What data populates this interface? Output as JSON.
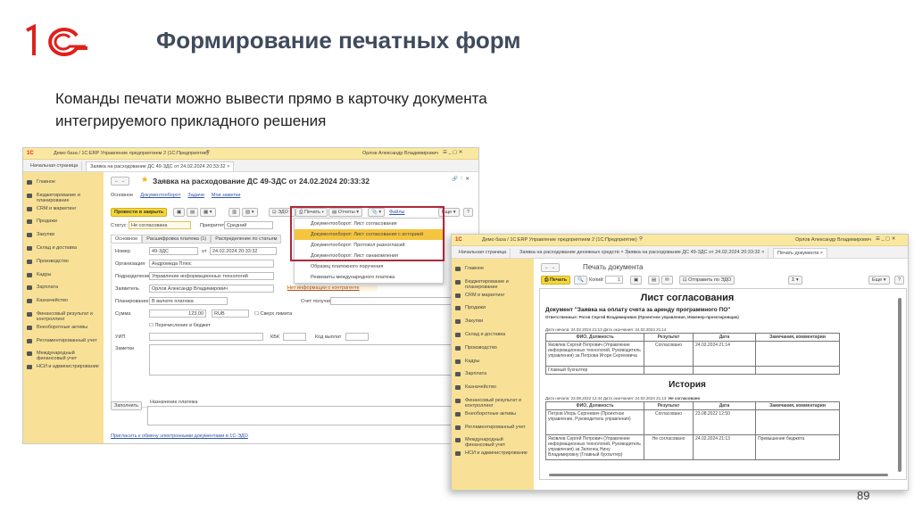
{
  "slide": {
    "title": "Формирование печатных форм",
    "subtitle_line1": "Команды печати можно вывести прямо в карточку документа",
    "subtitle_line2": "интегрируемого прикладного решения",
    "page_number": "89",
    "logo_text": "1С",
    "title_color": "#3f4a5c",
    "logo_color": "#e0201b"
  },
  "win1": {
    "title": "Демо база / 1С:ERP Управление предприятием 2  (1С:Предприятие)",
    "user": "Орлов Александр Владимирович",
    "tabs": [
      "Начальная страница",
      "Заявка на расходование ДС 49-ЗДС от 24.02.2024 20:33:32 ×"
    ],
    "sidebar": [
      "Главное",
      "Бюджетирование и планирование",
      "CRM и маркетинг",
      "Продажи",
      "Закупки",
      "Склад и доставка",
      "Производство",
      "Кадры",
      "Зарплата",
      "Казначейство",
      "Финансовый результат и контроллинг",
      "Внеоборотные активы",
      "Регламентированный учет",
      "Международный финансовый учет",
      "НСИ и администрирование"
    ],
    "header": "Заявка на расходование ДС 49-ЗДС от 24.02.2024 20:33:32",
    "nav": [
      "Основное",
      "Документооборот",
      "Задачи",
      "Мои заметки"
    ],
    "toolbar": {
      "post_close": "Провести и закрыть",
      "edo": "ЭДО",
      "print": "Печать",
      "reports": "Отчеты",
      "files": "Файлы",
      "more": "Еще",
      "help": "?"
    },
    "print_menu": [
      "Документооборот: Лист согласования",
      "Документооборот: Лист согласования с историей",
      "Документооборот: Протокол разногласий",
      "Документооборот: Лист ознакомления",
      "Образец платежного поручения",
      "Реквизиты международного платежа"
    ],
    "status_label": "Статус:",
    "status": "Не согласована",
    "priority_label": "Приоритет:",
    "priority": "Средний",
    "form_tabs": [
      "Основное",
      "Расшифровка платежа (1)",
      "Распределение по статьям"
    ],
    "fields": {
      "number_label": "Номер",
      "number": "49-ЗДС",
      "date_label": "от",
      "date": "24.02.2024 20:33:32",
      "org_label": "Организация",
      "org": "Андромеда Плюс",
      "dept_label": "Подразделение",
      "dept": "Управление информационных технологий",
      "applicant_label": "Заявитель",
      "applicant": "Орлов Александр Владимирович",
      "no_info": "Нет информации о контрагенте",
      "planning_label": "Планирование",
      "planning": "В валюте платежа",
      "account_label": "Счет получателя",
      "sum_label": "Сумма",
      "sum": "123,00",
      "currency": "RUB",
      "over_limit": "Сверх лимита",
      "budget": "Перечисление в бюджет",
      "uip_label": "УИП",
      "kbk_label": "КБК",
      "code_label": "Код выплат",
      "notes_label": "Заметки",
      "fill": "Заполнить",
      "purpose_label": "Назначение платежа",
      "invite": "Пригласить к обмену электронными документами в 1С-ЭДО"
    }
  },
  "win2": {
    "title": "Демо база / 1С:ERP Управление предприятием 2  (1С:Предприятие)",
    "user": "Орлов Александр Владимирович",
    "tabs": [
      "Начальная страница",
      "Заявка на расходование денежных средств ×",
      "Заявка на расходование ДС 49-ЗДС от 24.02.2024 20:33:32 ×",
      "Печать документа ×"
    ],
    "header": "Печать документа",
    "toolbar": {
      "print": "Печать",
      "copies_label": "Копий:",
      "copies": "1",
      "send": "Отправить по ЭДО",
      "sigma": "Σ",
      "more": "Еще",
      "help": "?"
    },
    "doc": {
      "title": "Лист согласования",
      "document": "Документ \"Заявка на оплату счета за аренду программного ПО\"",
      "responsible": "Ответственные: Рогов Сергей Владимирович (Проектное управление, Инженер-проектировщик)",
      "dates": "Дата начала: 24.02.2024 21:13 Дата окончания: 24.02.2024 21:14",
      "headers": [
        "ФИО, Должность",
        "Результат",
        "Дата",
        "Замечания, комментарии"
      ],
      "rows": [
        [
          "Яковлев Сергей Петрович (Управление информационных технологий, Руководитель управления) за Петрова Игоря Сергеевича",
          "Согласовано",
          "24.02.2024 21:14",
          ""
        ],
        [
          "Главный бухгалтер",
          "",
          "",
          ""
        ]
      ],
      "history_title": "История",
      "history_dates": "Дата начала: 23.08.2022 12:44 Дата окончания: 24.02.2024 21:13",
      "history_status": "Не согласовано",
      "history_rows": [
        [
          "Петров Игорь Сергеевич (Проектное управление, Руководитель управления)",
          "Согласовано",
          "23.08.2022 12:50",
          ""
        ],
        [
          "Яковлев Сергей Петрович (Управление информационных технологий, Руководитель управления) за Зеленец Нину Владимировну (Главный бухгалтер)",
          "Не согласовано",
          "24.02.2024 21:13",
          "Превышение бюджета"
        ]
      ]
    }
  }
}
